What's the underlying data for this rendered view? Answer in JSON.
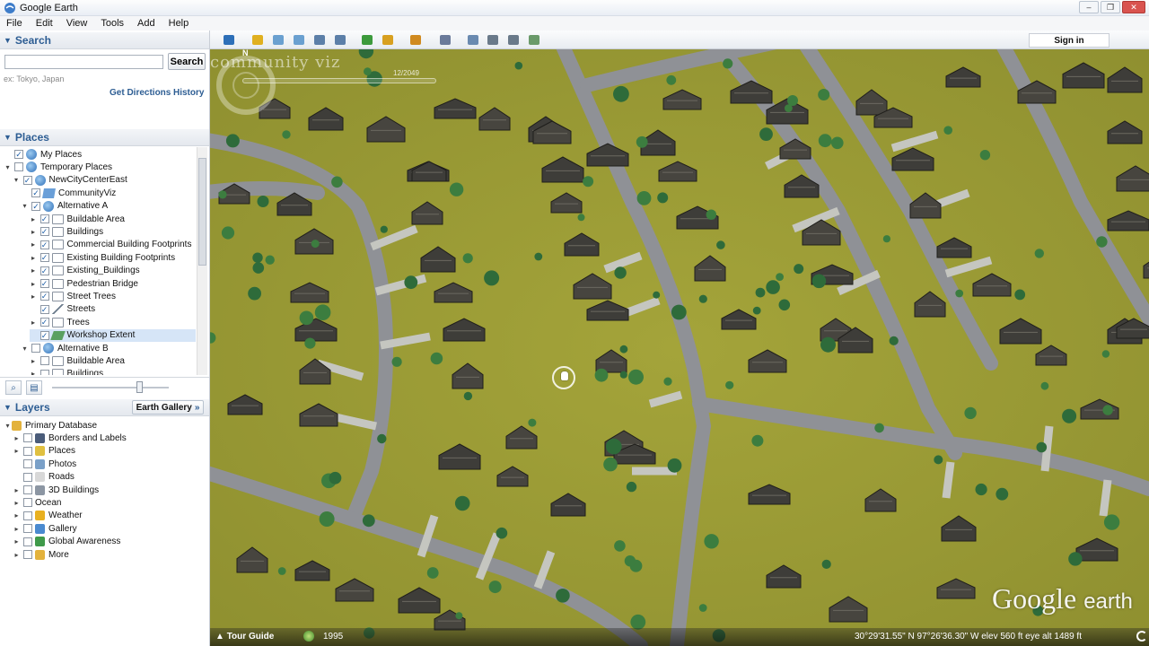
{
  "window": {
    "title": "Google Earth",
    "controls": [
      "–",
      "❐",
      "✕"
    ]
  },
  "menu": [
    "File",
    "Edit",
    "View",
    "Tools",
    "Add",
    "Help"
  ],
  "search": {
    "header": "Search",
    "input_value": "",
    "button_label": "Search",
    "hint": "ex: Tokyo, Japan",
    "get_directions": "Get Directions",
    "history": "History"
  },
  "places": {
    "header": "Places",
    "items": [
      {
        "label": "My Places",
        "indent": 0,
        "expander": "",
        "checked": true,
        "icon": "globe-icon"
      },
      {
        "label": "Temporary Places",
        "indent": 0,
        "expander": "▾",
        "checked": false,
        "icon": "globe-icon"
      },
      {
        "label": "NewCityCenterEast",
        "indent": 1,
        "expander": "▾",
        "checked": true,
        "icon": "globe-icon"
      },
      {
        "label": "CommunityViz",
        "indent": 2,
        "expander": "",
        "checked": true,
        "icon": "link-icon"
      },
      {
        "label": "Alternative A",
        "indent": 2,
        "expander": "▾",
        "checked": true,
        "icon": "globe-icon"
      },
      {
        "label": "Buildable Area",
        "indent": 3,
        "expander": "▸",
        "checked": true,
        "icon": "folder-icon"
      },
      {
        "label": "Buildings",
        "indent": 3,
        "expander": "▸",
        "checked": true,
        "icon": "folder-icon"
      },
      {
        "label": "Commercial Building Footprints",
        "indent": 3,
        "expander": "▸",
        "checked": true,
        "icon": "folder-icon"
      },
      {
        "label": "Existing Building Footprints",
        "indent": 3,
        "expander": "▸",
        "checked": true,
        "icon": "folder-icon"
      },
      {
        "label": "Existing_Buildings",
        "indent": 3,
        "expander": "▸",
        "checked": true,
        "icon": "folder-icon"
      },
      {
        "label": "Pedestrian Bridge",
        "indent": 3,
        "expander": "▸",
        "checked": true,
        "icon": "folder-icon"
      },
      {
        "label": "Street Trees",
        "indent": 3,
        "expander": "▸",
        "checked": true,
        "icon": "folder-icon"
      },
      {
        "label": "Streets",
        "indent": 3,
        "expander": "",
        "checked": true,
        "icon": "line-icon"
      },
      {
        "label": "Trees",
        "indent": 3,
        "expander": "▸",
        "checked": true,
        "icon": "folder-icon"
      },
      {
        "label": "Workshop Extent",
        "indent": 3,
        "expander": "",
        "checked": true,
        "icon": "polygon-icon",
        "selected": true
      },
      {
        "label": "Alternative B",
        "indent": 2,
        "expander": "▾",
        "checked": false,
        "icon": "globe-icon"
      },
      {
        "label": "Buildable Area",
        "indent": 3,
        "expander": "▸",
        "checked": false,
        "icon": "folder-icon"
      },
      {
        "label": "Buildings",
        "indent": 3,
        "expander": "▸",
        "checked": false,
        "icon": "folder-icon"
      }
    ]
  },
  "layers": {
    "header": "Layers",
    "gallery_button": "Earth Gallery",
    "items": [
      {
        "label": "Primary Database",
        "indent": 0,
        "expander": "▾",
        "checked": null,
        "icon": "database-icon",
        "color": "#e3b23c"
      },
      {
        "label": "Borders and Labels",
        "indent": 1,
        "expander": "▸",
        "checked": false,
        "icon": "borders-icon",
        "color": "#4a5c7a"
      },
      {
        "label": "Places",
        "indent": 1,
        "expander": "▸",
        "checked": false,
        "icon": "places-icon",
        "color": "#e0c040"
      },
      {
        "label": "Photos",
        "indent": 1,
        "expander": "",
        "checked": false,
        "icon": "photos-icon",
        "color": "#7aa0c8"
      },
      {
        "label": "Roads",
        "indent": 1,
        "expander": "",
        "checked": false,
        "icon": "roads-icon",
        "color": "#d8d8d8"
      },
      {
        "label": "3D Buildings",
        "indent": 1,
        "expander": "▸",
        "checked": false,
        "icon": "buildings-3d-icon",
        "color": "#8c96a3"
      },
      {
        "label": "Ocean",
        "indent": 1,
        "expander": "▸",
        "checked": false,
        "icon": "",
        "color": ""
      },
      {
        "label": "Weather",
        "indent": 1,
        "expander": "▸",
        "checked": false,
        "icon": "weather-icon",
        "color": "#e8b020"
      },
      {
        "label": "Gallery",
        "indent": 1,
        "expander": "▸",
        "checked": false,
        "icon": "gallery-icon",
        "color": "#4a8ad0"
      },
      {
        "label": "Global Awareness",
        "indent": 1,
        "expander": "▸",
        "checked": false,
        "icon": "global-awareness-icon",
        "color": "#3f9a4a"
      },
      {
        "label": "More",
        "indent": 1,
        "expander": "▸",
        "checked": false,
        "icon": "more-icon",
        "color": "#e3b23c"
      }
    ]
  },
  "toolbar": {
    "buttons": [
      "sidebar-toggle-icon",
      "placemark-icon",
      "polygon-icon",
      "path-icon",
      "overlay-icon",
      "record-tour-icon",
      "historical-imagery-icon",
      "sunlight-icon",
      "planets-icon",
      "ruler-icon",
      "email-icon",
      "print-icon",
      "save-image-icon",
      "google-maps-icon"
    ],
    "sign_in": "Sign in"
  },
  "map": {
    "overlay_logo": "community viz",
    "time_slider_date": "12/2049",
    "compass_north": "N",
    "brand": "Google",
    "brand_suffix": "earth"
  },
  "status": {
    "tour_guide": "Tour Guide",
    "year": "1995",
    "coords": "30°29'31.55\" N    97°26'36.30\" W   elev   560 ft        eye alt  1489 ft"
  },
  "colors": {
    "panel_header": "#2d5d93",
    "terrain": "#9b9c33",
    "road": "#8f9196"
  }
}
